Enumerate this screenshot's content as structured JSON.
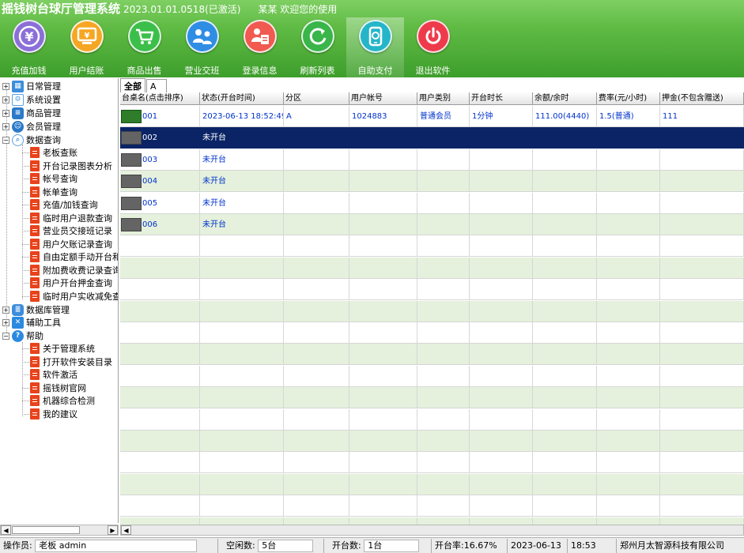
{
  "window": {
    "title": "摇钱树台球厅管理系统",
    "version": "2023.01.01.0518(已激活)",
    "welcome": "某某 欢迎您的使用"
  },
  "toolbar": [
    {
      "label": "充值加钱",
      "icon": "yen-coin-icon",
      "color": "#8b6fd8"
    },
    {
      "label": "用户结账",
      "icon": "checkout-screen-icon",
      "color": "#f5a623"
    },
    {
      "label": "商品出售",
      "icon": "shopping-cart-icon",
      "color": "#3cbf4a"
    },
    {
      "label": "营业交班",
      "icon": "user-swap-icon",
      "color": "#2f8de4"
    },
    {
      "label": "登录信息",
      "icon": "login-info-icon",
      "color": "#f05a50"
    },
    {
      "label": "刷新列表",
      "icon": "refresh-icon",
      "color": "#39b54a"
    },
    {
      "label": "自助支付",
      "icon": "mobile-pay-icon",
      "color": "#25b5c8"
    },
    {
      "label": "退出软件",
      "icon": "power-icon",
      "color": "#ee3b4b"
    }
  ],
  "tree": {
    "groups": {
      "daily": "日常管理",
      "system": "系统设置",
      "goods": "商品管理",
      "member": "会员管理",
      "query": "数据查询",
      "database": "数据库管理",
      "tools": "辅助工具",
      "help": "帮助"
    },
    "query_items": [
      "老板查账",
      "开台记录图表分析",
      "帐号查询",
      "帐单查询",
      "充值/加钱查询",
      "临时用户退款查询",
      "营业员交接班记录",
      "用户欠账记录查询",
      "自由定额手动开台和",
      "附加费收费记录查询",
      "用户开台押金查询",
      "临时用户实收减免查i"
    ],
    "help_items": [
      "关于管理系统",
      "打开软件安装目录",
      "软件激活",
      "摇钱树官网",
      "机器综合检测",
      "我的建议"
    ]
  },
  "tabs": [
    "全部",
    "A"
  ],
  "grid": {
    "columns": [
      "台桌名(点击排序)",
      "状态(开台时间)",
      "分区",
      "用户帐号",
      "用户类别",
      "开台时长",
      "余额/余时",
      "费率(元/小时)",
      "押金(不包含赠送)"
    ],
    "rows": [
      {
        "name": "001",
        "status": "2023-06-13 18:52:49",
        "zone": "A",
        "account": "1024883",
        "category": "普通会员",
        "duration": "1分钟",
        "balance": "111.00(4440)",
        "rate": "1.5(普通)",
        "deposit": "111",
        "busy": true
      },
      {
        "name": "002",
        "status": "未开台",
        "zone": "",
        "account": "",
        "category": "",
        "duration": "",
        "balance": "",
        "rate": "",
        "deposit": "",
        "busy": false
      },
      {
        "name": "003",
        "status": "未开台",
        "zone": "",
        "account": "",
        "category": "",
        "duration": "",
        "balance": "",
        "rate": "",
        "deposit": "",
        "busy": false
      },
      {
        "name": "004",
        "status": "未开台",
        "zone": "",
        "account": "",
        "category": "",
        "duration": "",
        "balance": "",
        "rate": "",
        "deposit": "",
        "busy": false
      },
      {
        "name": "005",
        "status": "未开台",
        "zone": "",
        "account": "",
        "category": "",
        "duration": "",
        "balance": "",
        "rate": "",
        "deposit": "",
        "busy": false
      },
      {
        "name": "006",
        "status": "未开台",
        "zone": "",
        "account": "",
        "category": "",
        "duration": "",
        "balance": "",
        "rate": "",
        "deposit": "",
        "busy": false
      }
    ],
    "selected_row": 1
  },
  "status_bar": {
    "operator_label": "操作员:",
    "operator": "老板 admin",
    "idle_label": "空闲数:",
    "idle": "5台",
    "open_label": "开台数:",
    "open": "1台",
    "rate_label": "开台率:16.67%",
    "date": "2023-06-13",
    "time": "18:53",
    "company": "郑州月太智源科技有限公司"
  }
}
